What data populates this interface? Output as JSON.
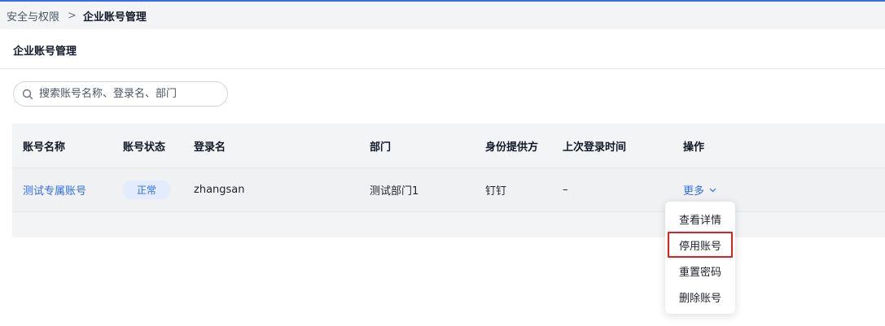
{
  "breadcrumb": {
    "root": "安全与权限",
    "separator": ">",
    "current": "企业账号管理"
  },
  "page": {
    "title": "企业账号管理"
  },
  "search": {
    "placeholder": "搜索账号名称、登录名、部门"
  },
  "table": {
    "headers": [
      "账号名称",
      "账号状态",
      "登录名",
      "部门",
      "身份提供方",
      "上次登录时间",
      "操作"
    ],
    "rows": [
      {
        "name": "测试专属账号",
        "status": "正常",
        "login": "zhangsan",
        "dept": "测试部门1",
        "idp": "钉钉",
        "last_login": "–",
        "action": "更多"
      }
    ]
  },
  "dropdown": {
    "items": [
      "查看详情",
      "停用账号",
      "重置密码",
      "删除账号"
    ],
    "highlighted": "停用账号"
  },
  "colors": {
    "accent": "#2f6fe4",
    "highlight_border": "#e02020"
  }
}
